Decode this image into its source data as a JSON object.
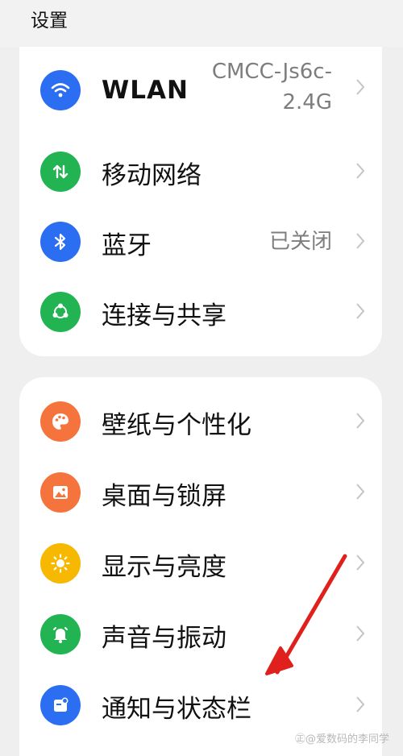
{
  "header": {
    "title": "设置"
  },
  "group1": [
    {
      "label": "WLAN",
      "value_line1": "CMCC-Js6c-",
      "value_line2": "2.4G",
      "icon": "wifi-icon",
      "color": "#2b6ef2"
    },
    {
      "label": "移动网络",
      "icon": "mobile-data-icon",
      "color": "#22b452"
    },
    {
      "label": "蓝牙",
      "value": "已关闭",
      "icon": "bluetooth-icon",
      "color": "#2b6ef2"
    },
    {
      "label": "连接与共享",
      "icon": "share-icon",
      "color": "#22b452"
    }
  ],
  "group2": [
    {
      "label": "壁纸与个性化",
      "icon": "palette-icon",
      "color": "#f5743d"
    },
    {
      "label": "桌面与锁屏",
      "icon": "image-icon",
      "color": "#f5743d"
    },
    {
      "label": "显示与亮度",
      "icon": "brightness-icon",
      "color": "#f6b800"
    },
    {
      "label": "声音与振动",
      "icon": "bell-icon",
      "color": "#22b452"
    },
    {
      "label": "通知与状态栏",
      "icon": "notification-icon",
      "color": "#2b6ef2"
    }
  ],
  "watermark": "爱数码的李同学",
  "annotation": {
    "arrow_color": "#e0201c"
  }
}
